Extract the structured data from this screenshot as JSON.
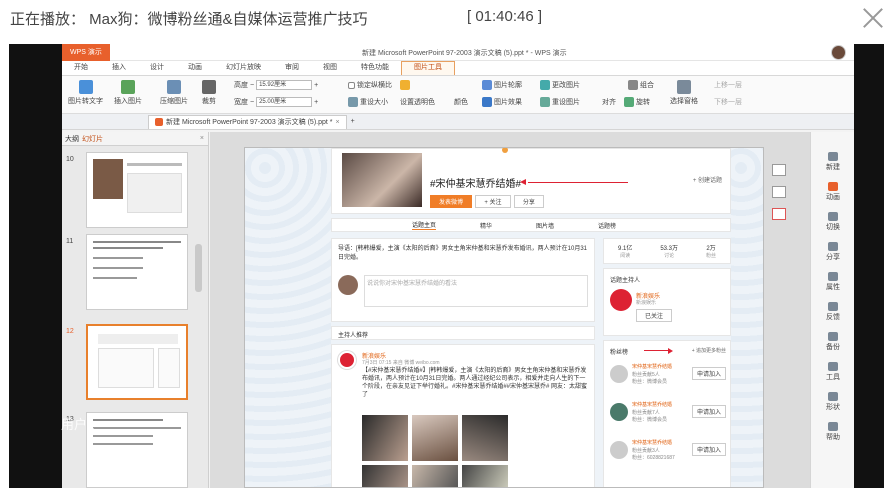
{
  "player": {
    "now_playing": "正在播放： Max狗：微博粉丝通&自媒体运营推广技巧",
    "timestamp": "[ 01:40:46 ]"
  },
  "app": {
    "brand": "WPS 演示",
    "window_title": "新建 Microsoft PowerPoint 97-2003 演示文稿 (5).ppt * - WPS 演示",
    "menu": [
      "开始",
      "插入",
      "设计",
      "动画",
      "幻灯片放映",
      "审阅",
      "视图",
      "特色功能",
      "图片工具"
    ],
    "active_menu_index": 8,
    "ribbon": {
      "btn_to_text": "图片转文字",
      "btn_insert_pic": "插入图片",
      "btn_compress": "压缩图片",
      "btn_crop": "裁剪",
      "lbl_height": "高度",
      "height_value": "15.92厘米",
      "lbl_width": "宽度",
      "width_value": "25.00厘米",
      "lock_ratio": "锁定纵横比",
      "reset_size": "重设大小",
      "transparent": "设置透明色",
      "color": "颜色",
      "outline": "图片轮廓",
      "effect": "图片效果",
      "change_pic": "更改图片",
      "reset_pic": "重设图片",
      "align": "对齐",
      "rotate": "旋转",
      "combine": "组合",
      "select_pane": "选择窗格",
      "bring_up": "上移一层",
      "send_down": "下移一层"
    },
    "doc_tab": "新建 Microsoft PowerPoint 97-2003 演示文稿 (5).ppt *",
    "left_pane_tabs": [
      "大纲",
      "幻灯片"
    ],
    "slide_numbers": [
      "10",
      "11",
      "12",
      "13"
    ],
    "right_sidebar": [
      "新建",
      "动画",
      "切换",
      "分享",
      "属性",
      "反馈",
      "备份",
      "工具",
      "形状",
      "帮助"
    ],
    "accent": "#e8602c"
  },
  "slide": {
    "topic_title": "#宋仲基宋慧乔结婚#",
    "follow_btn": "发表微博",
    "add_follow": "+ 关注",
    "share": "分享",
    "create_topic": "+ 创建话题",
    "tabs": [
      "话题主页",
      "精华",
      "图片墙",
      "话题榜"
    ],
    "intro": "导语：[韩韩爆爱，主演《太阳的后裔》男女主角宋仲基和宋慧乔发布婚讯，两人预计在10月31日完婚。",
    "comment_placeholder": "说说你对宋仲基宋慧乔结婚的看法",
    "host_recommend": "主持人推荐",
    "stats": [
      {
        "num": "9.1亿",
        "label": "阅读"
      },
      {
        "num": "53.3万",
        "label": "讨论"
      },
      {
        "num": "2万",
        "label": "粉丝"
      }
    ],
    "host_heading": "话题主持人",
    "host_name": "新浪娱乐",
    "host_sub": "新浪娱乐",
    "host_followed": "已关注",
    "fans_heading": "粉丝榜",
    "fans_link": "+ 追加更多粉丝",
    "fan_items": [
      {
        "name": "宋仲基宋慧乔结婚",
        "line1": "粉丝贡献5人",
        "line2": "粉丝：微博会员",
        "btn": "申请加入"
      },
      {
        "name": "宋仲基宋慧乔结婚",
        "line1": "粉丝贡献7人",
        "line2": "粉丝：微博会员",
        "btn": "申请加入"
      },
      {
        "name": "宋仲基宋慧乔结婚",
        "line1": "粉丝贡献3人",
        "line2": "粉丝：6028821687",
        "btn": "申请加入"
      }
    ],
    "post_author": "新浪娱乐",
    "post_meta": "7月3日 07:15 来自 微博 weibo.com",
    "post_text": "【#宋仲基宋慧乔结婚#】[韩韩爆爱，主演《太阳的后裔》男女主角宋仲基和宋慧乔发布婚讯，两人预计在10月31日完婚。两人通过经纪公司表示，相爱并走向人生的下一个阶段，在亲友见证下举行婚礼。#宋仲基宋慧乔结婚##宋仲基宋慧乔# 网友：太甜蜜了"
  },
  "watermark": "用户1"
}
